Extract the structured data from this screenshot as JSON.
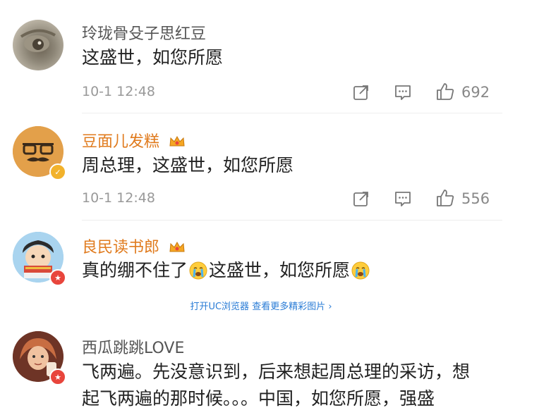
{
  "comments": [
    {
      "username": "玲珑骨殳子思红豆",
      "content": "这盛世，如您所愿",
      "time": "10-1 12:48",
      "likes": "692"
    },
    {
      "username": "豆面儿发糕",
      "content": "周总理，这盛世，如您所愿",
      "time": "10-1 12:48",
      "likes": "556"
    },
    {
      "username": "良民读书郎",
      "content_part1": "真的绷不住了",
      "content_part2": "这盛世，如您所愿"
    },
    {
      "username": "西瓜跳跳LOVE",
      "content_line1": "飞两遍。先没意识到，后来想起周总理的采访，想",
      "content_line2": "起飞两遍的那时候。。。中国，如您所愿，强盛"
    }
  ],
  "promo_link": "打开UC浏览器 查看更多精彩图片 ›",
  "colors": {
    "vip_name": "#e07b1e",
    "normal_name": "#555555",
    "link": "#2a7cd6",
    "badge_gold": "#f2b22b",
    "badge_red": "#e8453c"
  },
  "icons": [
    "share-icon",
    "comment-icon",
    "like-icon",
    "crown-icon",
    "crying-emoji"
  ]
}
